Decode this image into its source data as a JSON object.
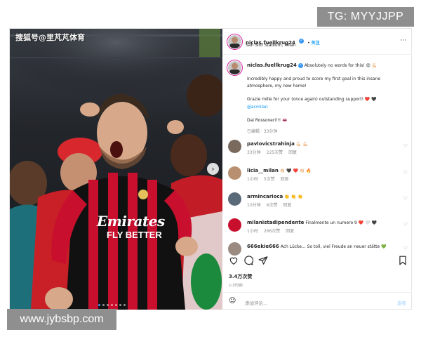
{
  "watermarks": {
    "top": "TG: MYYJJPP",
    "bottom": "www.jybsbp.com",
    "photo_source": "搜狐号@里芃芃体育"
  },
  "post": {
    "author": "niclas.fuellkrug24",
    "follow_label": "关注",
    "location": "San Siro Stadium, Milan",
    "jersey_text": [
      "Emirates",
      "FLY BETTER"
    ],
    "carousel_count": 7,
    "carousel_active": 1,
    "caption": {
      "author": "niclas.fuellkrug24",
      "line1": "Absolutely no words for this! 😍 💪🏻",
      "line2": "Incredibly happy and proud to score my first goal in this insane",
      "line3": "atmosphere, my new home!",
      "line4": "Grazie mille for your (once again) outstanding support! ❤️ 🖤",
      "mention": "@acmilan",
      "line5": "Dai Rossoneri!!! 👄",
      "meta": "已编辑 · 33分钟"
    },
    "comments": [
      {
        "user": "pavlovicstrahinja",
        "text": "💪🏻 💪🏻",
        "time": "33分钟",
        "likes": "225次赞",
        "reply": "回复"
      },
      {
        "user": "licia__milan",
        "text": "👏🏻 🖤 ❤️ 👏🏻 🔥",
        "time": "1小时",
        "likes": "5次赞",
        "reply": "回复"
      },
      {
        "user": "armincarioca",
        "text": "👏 👏 👏",
        "time": "10分钟",
        "likes": "6次赞",
        "reply": "回复"
      },
      {
        "user": "milanistadipendente",
        "text": "Finalmente un numero 9 ❤️ 🤍 🖤",
        "time": "1小时",
        "likes": "266次赞",
        "reply": "回复"
      },
      {
        "user": "666ekie666",
        "text": "Ach Lücke... So toll, viel Freude an neuer stätte 💚",
        "time": "",
        "likes": "",
        "reply": ""
      }
    ],
    "likes_count": "3.4万次赞",
    "posted_ago": "1小时前",
    "add_comment_placeholder": "添加评论...",
    "post_button": "发布"
  },
  "colors": {
    "accent": "#0095f6",
    "jersey_red": "#c8102e",
    "watermark_bg": "#8f8f8f"
  }
}
